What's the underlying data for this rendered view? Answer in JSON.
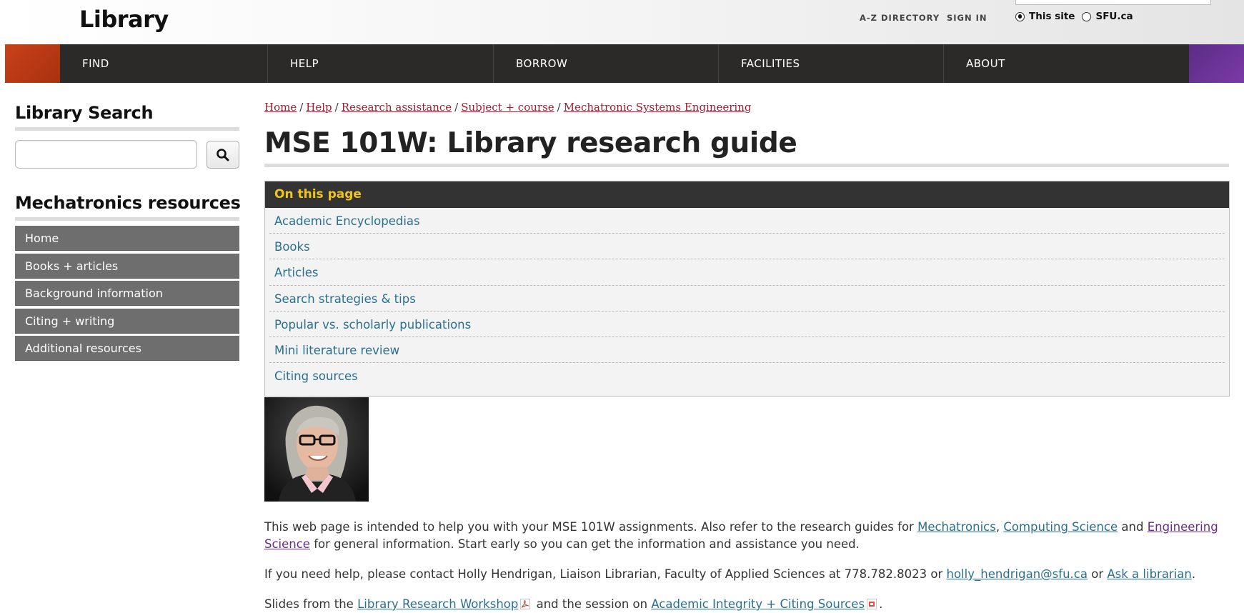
{
  "header": {
    "brand": "Library",
    "az_directory": "A-Z DIRECTORY",
    "sign_in": "SIGN IN",
    "scope_this_site": "This site",
    "scope_sfu": "SFU.ca"
  },
  "nav": {
    "items": [
      "FIND",
      "HELP",
      "BORROW",
      "FACILITIES",
      "ABOUT"
    ]
  },
  "sidebar": {
    "search_heading": "Library Search",
    "resources_heading": "Mechatronics resources",
    "menu": [
      "Home",
      "Books + articles",
      "Background information",
      "Citing + writing",
      "Additional resources"
    ]
  },
  "breadcrumb": [
    "Home",
    "Help",
    "Research assistance",
    "Subject + course",
    "Mechatronic Systems Engineering"
  ],
  "page_title": "MSE 101W: Library research guide",
  "toc": {
    "heading": "On this page",
    "items": [
      "Academic Encyclopedias",
      "Books",
      "Articles",
      "Search strategies & tips",
      "Popular vs. scholarly publications",
      "Mini literature review",
      "Citing sources"
    ]
  },
  "intro": {
    "p1_text_a": "This web page is intended to help you with your MSE 101W assignments. Also refer to the research guides for ",
    "p1_link_1": "Mechatronics",
    "p1_sep_1": ", ",
    "p1_link_2": "Computing Science",
    "p1_text_b": " and ",
    "p1_link_3": "Engineering Science",
    "p1_text_c": " for general information. Start early so you can get the information and assistance you need.",
    "p2_text_a": "If you need help, please contact Holly Hendrigan, Liaison Librarian, Faculty of Applied Sciences at 778.782.8023 or ",
    "p2_email": "holly_hendrigan@sfu.ca",
    "p2_text_b": " or ",
    "p2_link": "Ask a librarian",
    "p2_text_c": ".",
    "p3_text_a": "Slides from the ",
    "p3_link_1": "Library Research Workshop",
    "p3_text_b": " and the session on ",
    "p3_link_2": "Academic Integrity + Citing Sources",
    "p3_text_c": "."
  },
  "colors": {
    "nav_bg": "#2c2a29",
    "accent_red": "#a6192e",
    "accent_orange": "#c8421a",
    "accent_purple": "#6a2a8a",
    "toc_heading": "#f0c419",
    "link_blue": "#2a6f8f",
    "sidebar_menu_bg": "#6e6e6e"
  },
  "icons": {
    "search": "magnifier-icon",
    "pdf": "pdf-icon"
  }
}
